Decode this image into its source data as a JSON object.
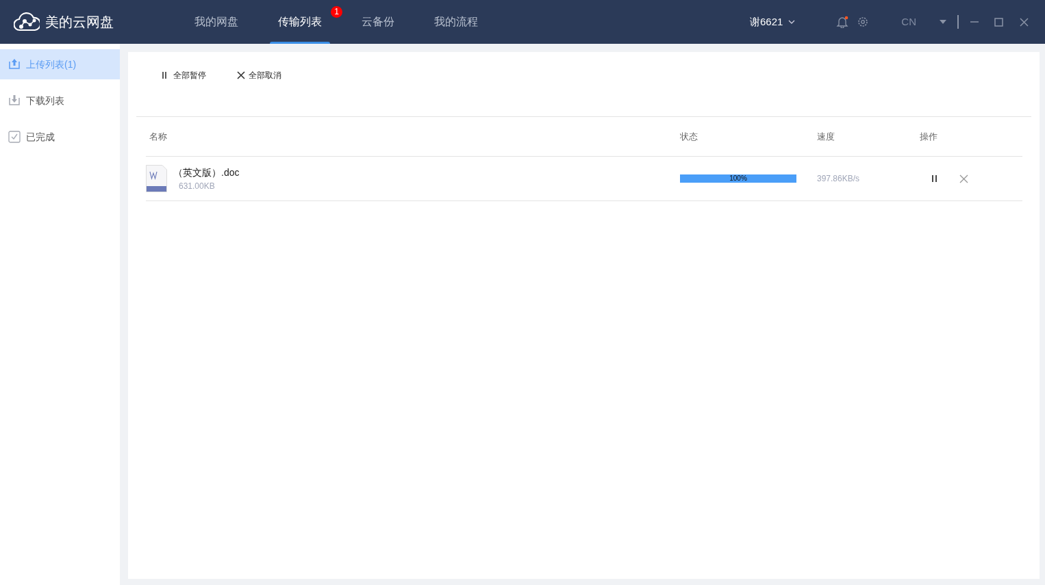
{
  "app": {
    "title": "美的云网盘"
  },
  "nav_tabs": [
    {
      "label": "我的网盘",
      "selected": false
    },
    {
      "label": "传输列表",
      "selected": true,
      "badge": "1"
    },
    {
      "label": "云备份",
      "selected": false
    },
    {
      "label": "我的流程",
      "selected": false
    }
  ],
  "user": {
    "name": "谢6621",
    "has_notification": true
  },
  "language": "CN",
  "sidebar": {
    "items": [
      {
        "kind": "upload",
        "label": "上传列表(1)",
        "selected": true
      },
      {
        "kind": "download",
        "label": "下载列表",
        "selected": false
      },
      {
        "kind": "done",
        "label": "已完成",
        "selected": false
      }
    ]
  },
  "toolbar": [
    {
      "kind": "pause",
      "label": "全部暂停"
    },
    {
      "kind": "cancel",
      "label": "全部取消"
    }
  ],
  "table": {
    "columns": [
      "名称",
      "状态",
      "速度",
      "操作"
    ],
    "rows": [
      {
        "name": "（英文版）.doc",
        "size": "631.00KB",
        "level": 1.0,
        "reading": "100%",
        "speed": "397.86KB/s"
      }
    ]
  }
}
